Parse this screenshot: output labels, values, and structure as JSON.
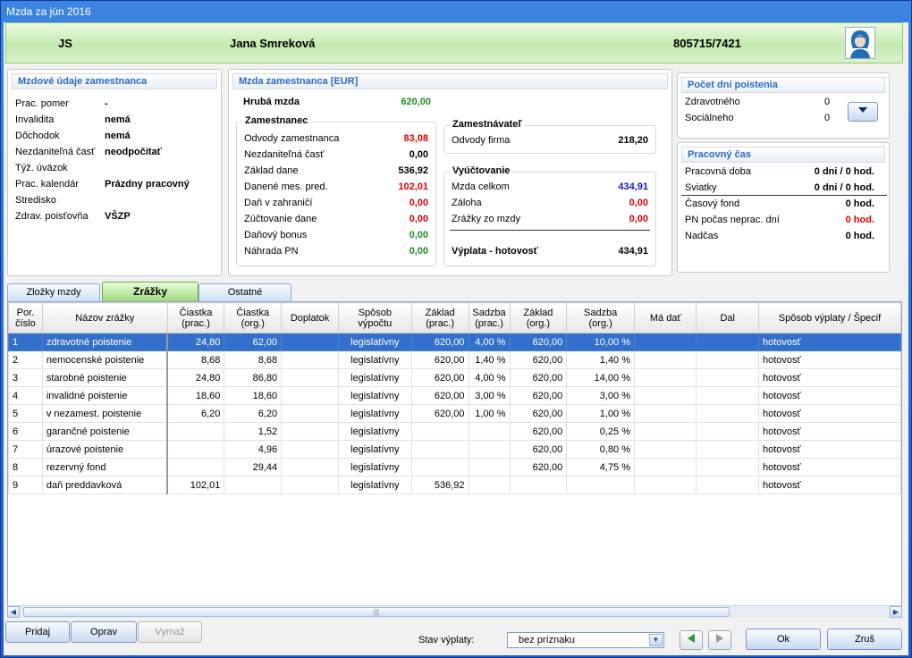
{
  "window": {
    "title": "Mzda za jún 2016"
  },
  "header": {
    "code": "JS",
    "name": "Jana Smreková",
    "id": "805715/7421"
  },
  "employee": {
    "title": "Mzdové údaje zamestnanca",
    "rows": [
      {
        "label": "Prac. pomer",
        "value": "-"
      },
      {
        "label": "Invalidita",
        "value": "nemá"
      },
      {
        "label": "Dôchodok",
        "value": "nemá"
      },
      {
        "label": "Nezdaniteľná časť",
        "value": "neodpočítať"
      },
      {
        "label": "Týž. úväzok",
        "value": ""
      },
      {
        "label": "Prac. kalendár",
        "value": "Prázdny pracovný"
      },
      {
        "label": "Stredisko",
        "value": ""
      },
      {
        "label": "Zdrav. poisťovňa",
        "value": "VŠZP"
      }
    ]
  },
  "salary": {
    "title": "Mzda zamestnanca [EUR]",
    "gross_label": "Hrubá mzda",
    "gross_value": "620,00",
    "employee_title": "Zamestnanec",
    "employee_rows": [
      {
        "label": "Odvody zamestnanca",
        "value": "83,08",
        "color": "#e00000"
      },
      {
        "label": "Nezdaniteľná časť",
        "value": "0,00",
        "color": "#000000"
      },
      {
        "label": "Základ dane",
        "value": "536,92",
        "color": "#000000"
      },
      {
        "label": "Danené mes. pred.",
        "value": "102,01",
        "color": "#e00000"
      },
      {
        "label": "Daň v zahraničí",
        "value": "0,00",
        "color": "#e00000"
      },
      {
        "label": "Zúčtovanie dane",
        "value": "0,00",
        "color": "#e00000"
      },
      {
        "label": "Daňový bonus",
        "value": "0,00",
        "color": "#1b8e1b"
      },
      {
        "label": "Náhrada PN",
        "value": "0,00",
        "color": "#1b8e1b"
      }
    ],
    "employer_title": "Zamestnávateľ",
    "employer_label": "Odvody firma",
    "employer_value": "218,20",
    "settlement_title": "Vyúčtovanie",
    "settlement_rows": [
      {
        "label": "Mzda celkom",
        "value": "434,91",
        "color": "#1515c8"
      },
      {
        "label": "Záloha",
        "value": "0,00",
        "color": "#e00000"
      },
      {
        "label": "Zrážky zo mzdy",
        "value": "0,00",
        "color": "#e00000"
      }
    ],
    "payout_label": "Výplata - hotovosť",
    "payout_value": "434,91"
  },
  "insurance": {
    "title": "Počet dní poistenia",
    "rows": [
      {
        "label": "Zdravotného",
        "value": "0"
      },
      {
        "label": "Sociálneho",
        "value": "0"
      }
    ]
  },
  "worktime": {
    "title": "Pracovný čas",
    "rows": [
      {
        "label": "Pracovná doba",
        "value": "0 dni / 0 hod.",
        "color": "#000000"
      },
      {
        "label": "Sviatky",
        "value": "0 dni / 0 hod.",
        "color": "#000000"
      },
      {
        "label": "Časový fond",
        "value": "0 hod.",
        "color": "#000000"
      },
      {
        "label": "PN počas neprac. dní",
        "value": "0 hod.",
        "color": "#e00000"
      },
      {
        "label": "Nadčas",
        "value": "0 hod.",
        "color": "#000000"
      }
    ]
  },
  "tabs": [
    {
      "label": "Zložky mzdy",
      "active": false
    },
    {
      "label": "Zrážky",
      "active": true
    },
    {
      "label": "Ostatné",
      "active": false
    }
  ],
  "grid": {
    "columns": [
      "Por.\nčíslo",
      "Názov zrážky",
      "Čiastka\n(prac.)",
      "Čiastka\n(org.)",
      "Doplatok",
      "Spôsob\nvýpočtu",
      "Základ\n(prac.)",
      "Sadzba\n(prac.)",
      "Základ\n(org.)",
      "Sadzba\n(org.)",
      "Má dať",
      "Dal",
      "Spôsob výplaty / Špecif"
    ],
    "rows": [
      [
        "1",
        "zdravotné poistenie",
        "24,80",
        "62,00",
        "",
        "legislatívny",
        "620,00",
        "4,00 %",
        "620,00",
        "10,00 %",
        "",
        "",
        "hotovosť"
      ],
      [
        "2",
        "nemocenské poistenie",
        "8,68",
        "8,68",
        "",
        "legislatívny",
        "620,00",
        "1,40 %",
        "620,00",
        "1,40 %",
        "",
        "",
        "hotovosť"
      ],
      [
        "3",
        "starobné poistenie",
        "24,80",
        "86,80",
        "",
        "legislatívny",
        "620,00",
        "4,00 %",
        "620,00",
        "14,00 %",
        "",
        "",
        "hotovosť"
      ],
      [
        "4",
        "invalidné poistenie",
        "18,60",
        "18,60",
        "",
        "legislatívny",
        "620,00",
        "3,00 %",
        "620,00",
        "3,00 %",
        "",
        "",
        "hotovosť"
      ],
      [
        "5",
        "v nezamest. poistenie",
        "6,20",
        "6,20",
        "",
        "legislatívny",
        "620,00",
        "1,00 %",
        "620,00",
        "1,00 %",
        "",
        "",
        "hotovosť"
      ],
      [
        "6",
        "garančné poistenie",
        "",
        "1,52",
        "",
        "legislatívny",
        "",
        "",
        "620,00",
        "0,25 %",
        "",
        "",
        "hotovosť"
      ],
      [
        "7",
        "úrazové poistenie",
        "",
        "4,96",
        "",
        "legislatívny",
        "",
        "",
        "620,00",
        "0,80 %",
        "",
        "",
        "hotovosť"
      ],
      [
        "8",
        "rezervný fond",
        "",
        "29,44",
        "",
        "legislatívny",
        "",
        "",
        "620,00",
        "4,75 %",
        "",
        "",
        "hotovosť"
      ],
      [
        "9",
        "daň preddavková",
        "102,01",
        "",
        "",
        "legislatívny",
        "536,92",
        "",
        "",
        "",
        "",
        "",
        "hotovosť"
      ]
    ],
    "selected_row": 0
  },
  "buttons": {
    "add": "Pridaj",
    "edit": "Oprav",
    "delete": "Vymaž",
    "ok": "Ok",
    "cancel": "Zruš"
  },
  "status": {
    "label": "Stav výplaty:",
    "value": "bez príznaku"
  }
}
